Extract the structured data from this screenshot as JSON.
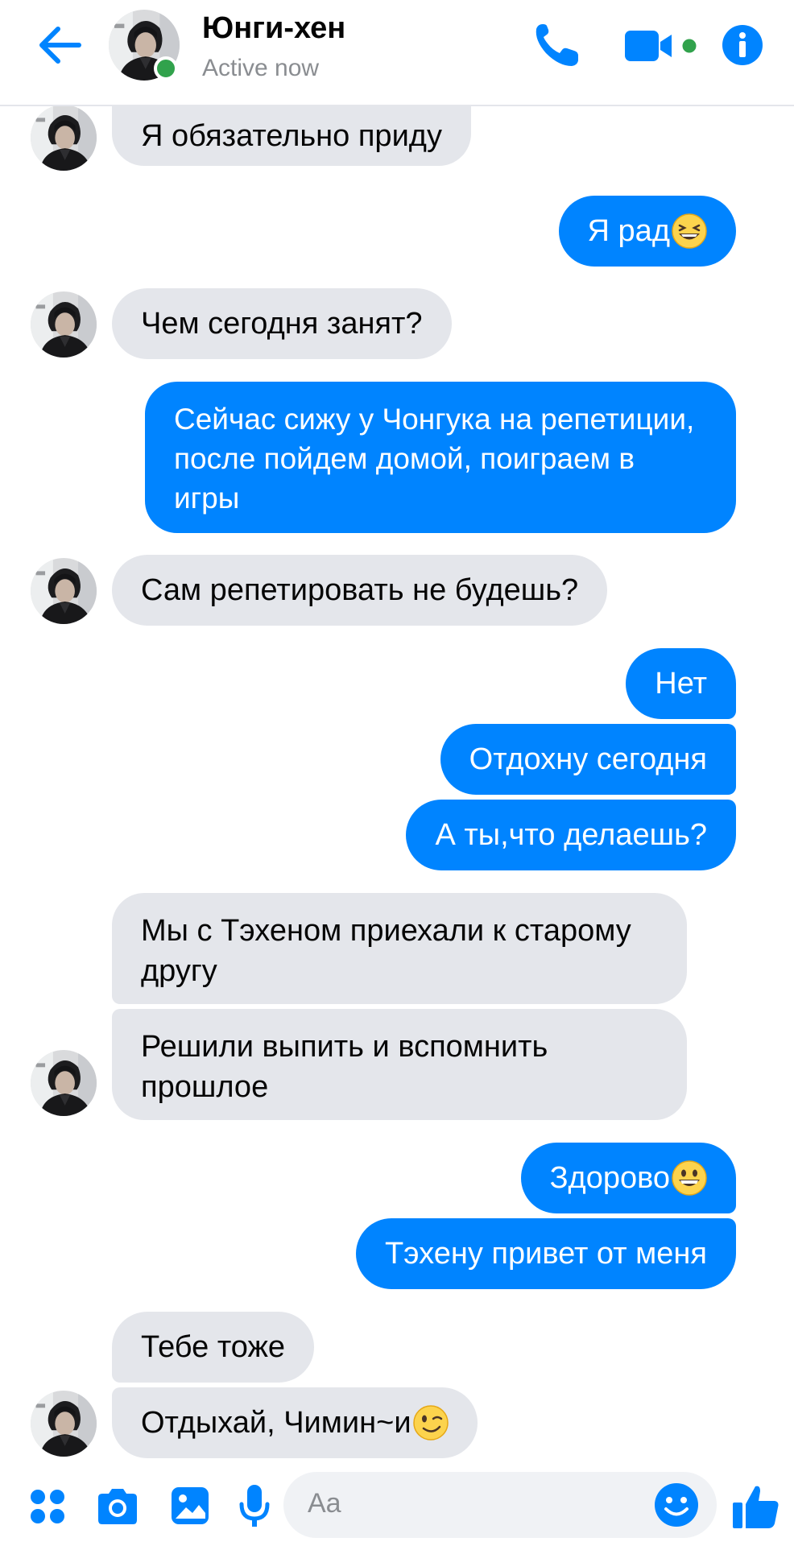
{
  "header": {
    "contact_name": "Юнги-хен",
    "status": "Active now",
    "accent_color": "#0084ff",
    "online_color": "#31a24c",
    "icons": [
      "back-arrow-icon",
      "phone-icon",
      "video-camera-icon",
      "info-icon"
    ]
  },
  "messages": [
    {
      "side": "in",
      "text": "Я обязательно приду"
    },
    {
      "side": "out",
      "text": "Я рад",
      "emoji": "grinning-squint"
    },
    {
      "side": "in",
      "text": "Чем сегодня занят?"
    },
    {
      "side": "out",
      "text": "Сейчас сижу у Чонгука на репетиции, после пойдем домой, поиграем в игры"
    },
    {
      "side": "in",
      "text": "Сам репетировать не будешь?"
    },
    {
      "side": "out",
      "text": "Нет"
    },
    {
      "side": "out",
      "text": "Отдохну сегодня"
    },
    {
      "side": "out",
      "text": "А ты,что делаешь?"
    },
    {
      "side": "in",
      "text": "Мы с Тэхеном приехали к старому другу"
    },
    {
      "side": "in",
      "text": "Решили выпить и вспомнить прошлое"
    },
    {
      "side": "out",
      "text": "Здорово",
      "emoji": "grinning"
    },
    {
      "side": "out",
      "text": "Тэхену привет от меня"
    },
    {
      "side": "in",
      "text": "Тебе тоже"
    },
    {
      "side": "in",
      "text": "Отдыхай, Чимин~и",
      "emoji": "winking"
    }
  ],
  "composer": {
    "placeholder": "Aa",
    "icons": [
      "apps-icon",
      "camera-icon",
      "gallery-icon",
      "microphone-icon",
      "emoji-icon",
      "thumbs-up-icon"
    ]
  }
}
